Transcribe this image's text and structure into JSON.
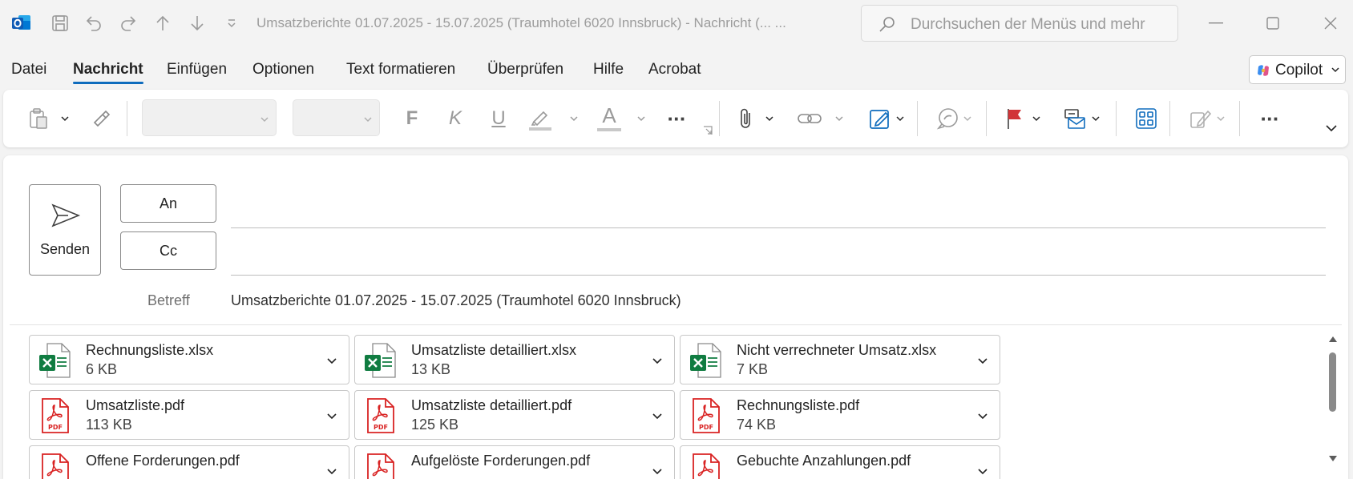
{
  "titlebar": {
    "window_title": "Umsatzberichte 01.07.2025 - 15.07.2025 (Traumhotel  6020 Innsbruck)  -  Nachricht (...   ...",
    "search_placeholder": "Durchsuchen der Menüs und mehr",
    "quick_access": [
      "save-icon",
      "undo-icon",
      "redo-icon",
      "arrow-up-icon",
      "arrow-down-icon",
      "customize-icon"
    ]
  },
  "menu": {
    "items": [
      "Datei",
      "Nachricht",
      "Einfügen",
      "Optionen",
      "Text formatieren",
      "Überprüfen",
      "Hilfe",
      "Acrobat"
    ],
    "active": "Nachricht",
    "copilot_label": "Copilot"
  },
  "ribbon": {
    "bold_glyph": "F",
    "italic_glyph": "K",
    "underline_glyph": "U",
    "font_color_glyph": "A",
    "more_glyph": "···"
  },
  "compose": {
    "send_label": "Senden",
    "to_label": "An",
    "cc_label": "Cc",
    "subject_label": "Betreff",
    "subject_value": "Umsatzberichte 01.07.2025 - 15.07.2025 (Traumhotel 6020 Innsbruck)"
  },
  "attachments": [
    {
      "name": "Rechnungsliste.xlsx",
      "size": "6 KB",
      "type": "xlsx"
    },
    {
      "name": "Umsatzliste detailliert.xlsx",
      "size": "13 KB",
      "type": "xlsx"
    },
    {
      "name": "Nicht verrechneter Umsatz.xlsx",
      "size": "7 KB",
      "type": "xlsx"
    },
    {
      "name": "Umsatzliste.pdf",
      "size": "113 KB",
      "type": "pdf"
    },
    {
      "name": "Umsatzliste detailliert.pdf",
      "size": "125 KB",
      "type": "pdf"
    },
    {
      "name": "Rechnungsliste.pdf",
      "size": "74 KB",
      "type": "pdf"
    },
    {
      "name": "Offene Forderungen.pdf",
      "size": "",
      "type": "pdf"
    },
    {
      "name": "Aufgelöste Forderungen.pdf",
      "size": "",
      "type": "pdf"
    },
    {
      "name": "Gebuchte Anzahlungen.pdf",
      "size": "",
      "type": "pdf"
    }
  ],
  "colors": {
    "accent": "#0f6cbd",
    "excel_green": "#107c41",
    "pdf_red": "#d92323",
    "flag_red": "#d13438"
  }
}
